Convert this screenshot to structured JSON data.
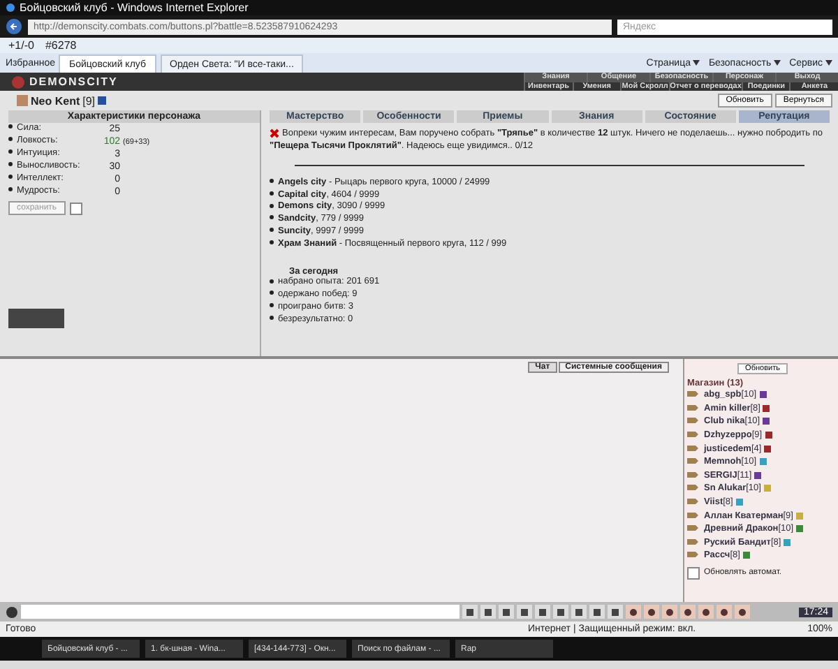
{
  "browser": {
    "title": "Бойцовский клуб - Windows Internet Explorer",
    "address": "http://demonscity.combats.com/buttons.pl?battle=8.523587910624293",
    "search_placeholder": "Яндекс",
    "toolbar": [
      "+1/-0",
      "#6278"
    ],
    "favorites": "Избранное",
    "tabs": [
      {
        "label": "Бойцовский клуб",
        "selected": true
      },
      {
        "label": "Орден Света: \"И все-таки...",
        "selected": false
      }
    ],
    "commands": [
      "Страница",
      "Безопасность",
      "Сервис"
    ]
  },
  "game": {
    "logo": "DEMONSCITY",
    "menu_top": [
      "Знания",
      "Общение",
      "Безопасность",
      "Персонаж",
      "Выход"
    ],
    "menu_bottom": [
      "Инвентарь",
      "Умения",
      "Мой Скролл",
      "Отчет о переводах",
      "Поединки",
      "Анкета"
    ],
    "character": {
      "name": "Neo Kent",
      "level": "[9]"
    },
    "buttons": [
      "Обновить",
      "Вернуться"
    ]
  },
  "stats": {
    "title": "Характеристики персонажа",
    "rows": [
      {
        "label": "Сила:",
        "value": "25",
        "boosted": false
      },
      {
        "label": "Ловкость:",
        "value": "102",
        "bonus": "(69+33)",
        "boosted": true
      },
      {
        "label": "Интуиция:",
        "value": "3",
        "boosted": false
      },
      {
        "label": "Выносливость:",
        "value": "30",
        "boosted": false
      },
      {
        "label": "Интеллект:",
        "value": "0",
        "boosted": false
      },
      {
        "label": "Мудрость:",
        "value": "0",
        "boosted": false
      }
    ],
    "save_button": "сохранить",
    "save_checked": false
  },
  "tabs": [
    {
      "label": "Мастерство",
      "selected": false
    },
    {
      "label": "Особенности",
      "selected": false
    },
    {
      "label": "Приемы",
      "selected": false
    },
    {
      "label": "Знания",
      "selected": false
    },
    {
      "label": "Состояние",
      "selected": false
    },
    {
      "label": "Репутация",
      "selected": true
    }
  ],
  "quest": "Вопреки чужим интересам, Вам поручено собрать **\"Тряпье\"** в количестве **12** штук. Ничего не поделаешь... нужно побродить по **\"Пещера Тысячи Проклятий\"**. Надеюсь еще увидимся.. 0/12",
  "reputation": [
    "**Angels city** - Рыцарь первого круга, 10000 / 24999",
    "**Capital city**, 4604 / 9999",
    "**Demons city**, 3090 / 9999",
    "**Sandcity**, 779 / 9999",
    "**Suncity**, 9997 / 9999",
    "**Храм Знаний** - Посвященный первого круга, 112 / 999"
  ],
  "today": {
    "title": "За сегодня",
    "items": [
      "набрано опыта: 201 691",
      "одержано побед: 9",
      "проиграно битв: 3",
      "безрезультатно: 0"
    ]
  },
  "chat_tabs": [
    {
      "label": "Чат",
      "selected": false
    },
    {
      "label": "Системные сообщения",
      "selected": true
    }
  ],
  "online": {
    "refresh": "Обновить",
    "title": "Магазин (13)",
    "users": [
      {
        "name": "abg_spb",
        "level": "[10]",
        "color": "#6a3a9a"
      },
      {
        "name": "Amin killer",
        "level": "[8]",
        "color": "#9a2a2a"
      },
      {
        "name": "Club nika",
        "level": "[10]",
        "color": "#6a3a9a"
      },
      {
        "name": "Dzhyzeppo",
        "level": "[9]",
        "color": "#9a2a2a"
      },
      {
        "name": "justicedem",
        "level": "[4]",
        "color": "#9a2a2a"
      },
      {
        "name": "Memnoh",
        "level": "[10]",
        "color": "#3aa0c0"
      },
      {
        "name": "SERGIJ",
        "level": "[11]",
        "color": "#6a3a9a"
      },
      {
        "name": "Sn Alukar",
        "level": "[10]",
        "color": "#c8b040"
      },
      {
        "name": "Viist",
        "level": "[8]",
        "color": "#3aa0c0"
      },
      {
        "name": "Аллан Кватерман",
        "level": "[9]",
        "color": "#c8b040"
      },
      {
        "name": "Древний Дракон",
        "level": "[10]",
        "color": "#3a8a3a"
      },
      {
        "name": "Руский Бандит",
        "level": "[8]",
        "color": "#3aa0c0"
      },
      {
        "name": "Рассч",
        "level": "[8]",
        "color": "#3a8a3a"
      }
    ],
    "auto_refresh": {
      "label": "Обновлять автомат.",
      "checked": false
    }
  },
  "clock": "17:24",
  "status_bar": {
    "text": "Готово",
    "zone": "Интернет | Защищенный режим: вкл.",
    "zoom": "100%"
  },
  "taskbar": [
    "Бойцовский клуб - ...",
    "1. бк-шная - Wina...",
    "[434-144-773] - Окн...",
    "Поиск по файлам - ...",
    "Rap"
  ]
}
